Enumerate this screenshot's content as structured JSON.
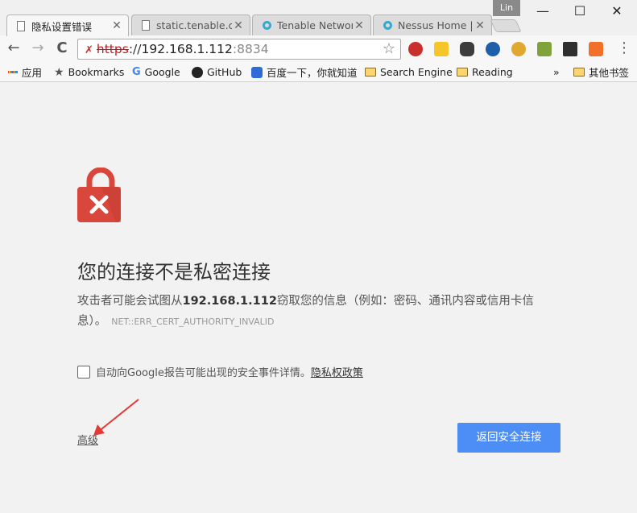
{
  "window": {
    "profile_name": "Lin",
    "minimize": "—",
    "maximize": "☐",
    "close": "✕"
  },
  "tabs": [
    {
      "title": "隐私设置错误",
      "icon": "document-icon",
      "active": true
    },
    {
      "title": "static.tenable.co",
      "icon": "document-icon",
      "active": false
    },
    {
      "title": "Tenable Network",
      "icon": "tenable-icon",
      "active": false
    },
    {
      "title": "Nessus Home | T",
      "icon": "tenable-icon",
      "active": false
    }
  ],
  "toolbar": {
    "back": "←",
    "forward": "→",
    "reload": "C",
    "home": "⌂",
    "url_scheme": "https",
    "url_sep": "://",
    "url_host": "192.168.1.112",
    "url_port": ":8834",
    "star": "☆",
    "menu": "⋮"
  },
  "bookmarks": {
    "items": [
      "应用",
      "Bookmarks",
      "Google",
      "GitHub",
      "百度一下，你就知道",
      "Search Engine",
      "Reading"
    ],
    "overflow": "»",
    "other": "其他书签"
  },
  "interstitial": {
    "heading": "您的连接不是私密连接",
    "desc_prefix": "攻击者可能会试图从",
    "desc_host": "192.168.1.112",
    "desc_suffix": "窃取您的信息（例如：密码、通讯内容或信用卡信息）。",
    "error_code": "NET::ERR_CERT_AUTHORITY_INVALID",
    "report_text": "自动向Google报告可能出现的安全事件详情。",
    "privacy_link": "隐私权政策",
    "report_checked": false,
    "advanced_link": "高级",
    "back_button": "返回安全连接"
  },
  "colors": {
    "lock_red": "#d9463b",
    "button_blue": "#4c8df6",
    "annotation_arrow": "#e53935"
  }
}
